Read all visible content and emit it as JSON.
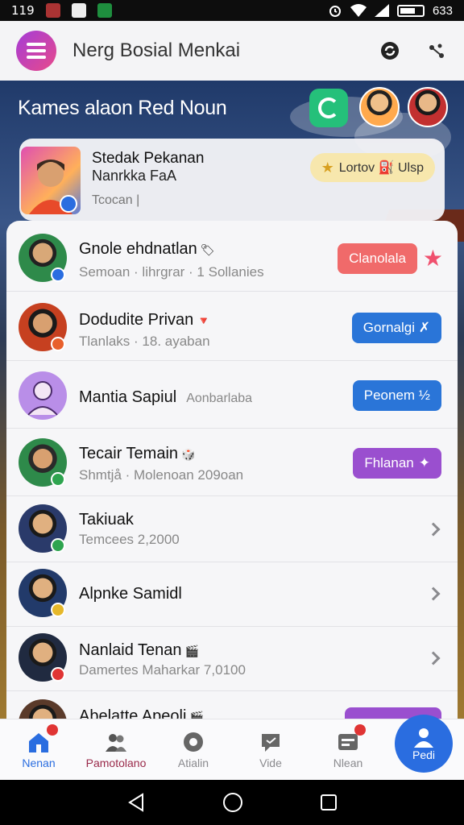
{
  "status_bar": {
    "time": "119",
    "battery": "633"
  },
  "app_bar": {
    "title": "Nerg Bosial Menkai",
    "logo_icon": "menu-lines-icon"
  },
  "hero": {
    "title": "Kames alaon Red Noun",
    "feature": {
      "name": "Stedak Pekanan",
      "subtitle": "Nanrkka FaA",
      "tag": "Tcocan |",
      "pill_label": "Lortov ⛽ Ulsp"
    }
  },
  "contacts": [
    {
      "name": "Gnole ehdnatlan",
      "meta": "Semoan · lihrgrar · 1 Sollanies",
      "action": "Clanolala",
      "action_color": "#f06a6a",
      "badge_color": "#2a6de0",
      "emoji": "🏷"
    },
    {
      "name": "Dodudite Privan",
      "meta": "Tlanlaks · 18. ayaban",
      "action": "Gornalgi ✗",
      "action_color": "#2a75d8",
      "badge_color": "#e8602c",
      "emoji": "🔻"
    },
    {
      "name": "Mantia Sapiul",
      "inline_meta": "Aonbarlaba",
      "action": "Peonem ½",
      "action_color": "#2a75d8",
      "badge_color": "",
      "emoji": ""
    },
    {
      "name": "Tecair Temain",
      "meta": "Shmtjå · Molenoan 209oan",
      "action": "Fhlanan",
      "action_color": "#9a4fcf",
      "badge_color": "#2ea44f",
      "emoji": "🎲"
    },
    {
      "name": "Takiuak",
      "meta": "Temcees 2,2000",
      "action": "",
      "badge_color": "#2ea44f",
      "emoji": ""
    },
    {
      "name": "Alpnke Samidl",
      "meta": "",
      "action": "",
      "badge_color": "#e6b82a",
      "emoji": ""
    },
    {
      "name": "Nanlaid Tenan",
      "meta": "Damertes Maharkar 7,0100",
      "action": "",
      "badge_color": "#e03434",
      "emoji": "🎬"
    },
    {
      "name": "Abelatte Apeoli",
      "meta": "",
      "action": "",
      "action_color": "#9a4fcf",
      "badge_color": "",
      "emoji": "🎬"
    }
  ],
  "bottom_nav": [
    {
      "label": "Nenan",
      "icon": "home-icon"
    },
    {
      "label": "Pamotolano",
      "icon": "people-icon"
    },
    {
      "label": "Atialin",
      "icon": "explore-icon"
    },
    {
      "label": "Vide",
      "icon": "chat-icon"
    },
    {
      "label": "Nlean",
      "icon": "inbox-icon"
    },
    {
      "label": "Pedi",
      "icon": "profile-icon"
    }
  ],
  "colors": {
    "accent": "#2a6de0",
    "purple": "#9a4fcf",
    "coral": "#f06a6a"
  }
}
